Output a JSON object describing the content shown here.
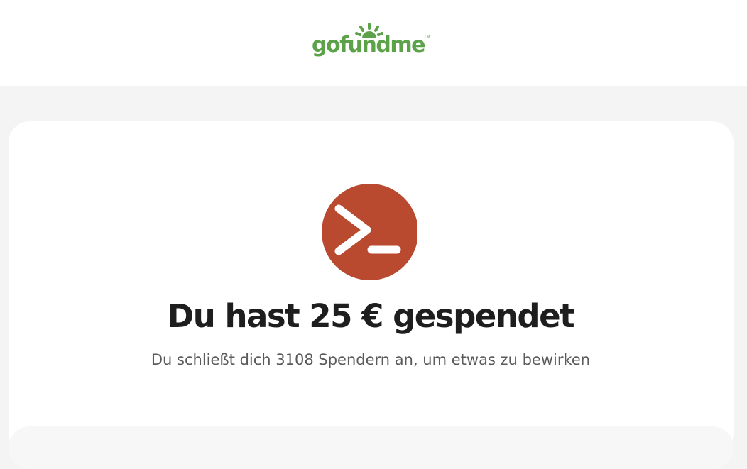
{
  "header": {
    "logo": {
      "text": "gofundme",
      "tm": "TM",
      "brand_color": "#5ba249",
      "icon": "sun-rays-icon"
    }
  },
  "confirmation": {
    "icon": "terminal-prompt-icon",
    "icon_color": "#b94a2f",
    "title": "Du hast 25 € gespendet",
    "subtitle": "Du schließt dich 3108 Spendern an, um etwas zu bewirken"
  }
}
